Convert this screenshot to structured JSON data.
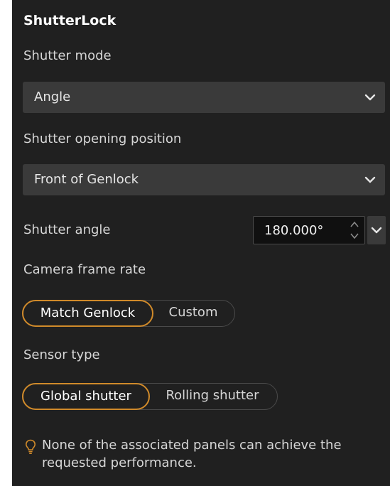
{
  "panel": {
    "title": "ShutterLock"
  },
  "shutter_mode": {
    "label": "Shutter mode",
    "value": "Angle"
  },
  "opening_position": {
    "label": "Shutter opening position",
    "value": "Front of Genlock"
  },
  "shutter_angle": {
    "label": "Shutter angle",
    "value": "180.000°"
  },
  "frame_rate": {
    "label": "Camera frame rate",
    "options": [
      "Match Genlock",
      "Custom"
    ],
    "selected": "Match Genlock"
  },
  "sensor_type": {
    "label": "Sensor type",
    "options": [
      "Global shutter",
      "Rolling shutter"
    ],
    "selected": "Global shutter"
  },
  "warning": {
    "icon": "lightbulb-icon",
    "text": "None of the associated panels can achieve the requested performance."
  },
  "colors": {
    "panel_bg": "#202020",
    "dropdown_bg": "#3a3a3a",
    "accent": "#d08a2a",
    "text": "#e6e6e6"
  }
}
